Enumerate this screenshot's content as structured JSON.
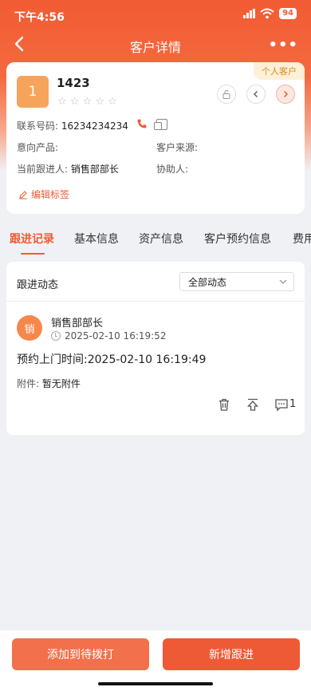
{
  "status": {
    "time": "下午4:56",
    "battery": "94"
  },
  "nav": {
    "title": "客户详情"
  },
  "customer": {
    "type_tag": "个人客户",
    "avatar_text": "1",
    "name": "1423",
    "stars": "☆ ☆ ☆ ☆ ☆",
    "phone_label": "联系号码:",
    "phone": "16234234234",
    "product_label": "意向产品:",
    "product": "",
    "source_label": "客户来源:",
    "source": "",
    "follower_label": "当前跟进人:",
    "follower": "销售部部长",
    "assistant_label": "协助人:",
    "assistant": "",
    "edit_tag": "编辑标签"
  },
  "tabs": [
    "跟进记录",
    "基本信息",
    "资产信息",
    "客户预约信息",
    "费用"
  ],
  "follow": {
    "header_label": "跟进动态",
    "filter_value": "全部动态",
    "record": {
      "avatar_text": "销",
      "name": "销售部部长",
      "time": "2025-02-10 16:19:52",
      "content": "预约上门时间:2025-02-10 16:19:49",
      "attach_label": "附件:",
      "attach_value": "暂无附件",
      "comment_count": "1"
    }
  },
  "bottom": {
    "secondary_label": "添加到待拨打",
    "primary_label": "新增跟进"
  },
  "colors": {
    "accent": "#f25b33",
    "tag_bg": "#fdf0d8",
    "tag_text": "#d98a1c"
  }
}
